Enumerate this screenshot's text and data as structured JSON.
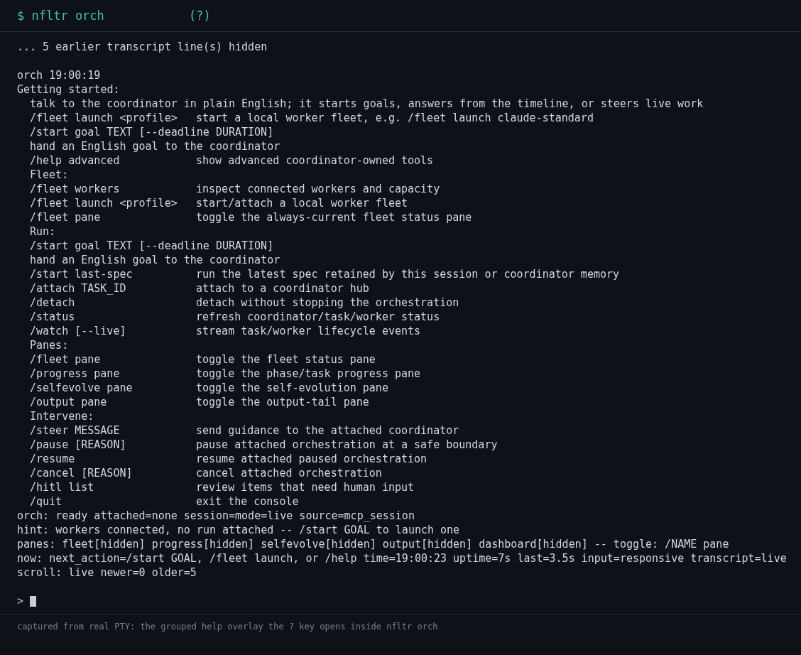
{
  "header": {
    "title": "$ nfltr orch",
    "help": "(?)"
  },
  "transcript": {
    "hidden_notice": "... 5 earlier transcript line(s) hidden",
    "entry": {
      "stamp": "orch 19:00:19",
      "lines": [
        {
          "kind": "heading",
          "text": "Getting started:"
        },
        {
          "kind": "text",
          "text": "talk to the coordinator in plain English; it starts goals, answers from the timeline, or steers live work"
        },
        {
          "kind": "command",
          "command": "/fleet launch <profile>",
          "description": "start a local worker fleet, e.g. /fleet launch claude-standard"
        },
        {
          "kind": "text",
          "text": "/start goal TEXT [--deadline DURATION]"
        },
        {
          "kind": "text",
          "text": "hand an English goal to the coordinator"
        },
        {
          "kind": "command",
          "command": "/help advanced",
          "description": "show advanced coordinator-owned tools"
        },
        {
          "kind": "text",
          "text": "Fleet:"
        },
        {
          "kind": "command",
          "command": "/fleet workers",
          "description": "inspect connected workers and capacity"
        },
        {
          "kind": "command",
          "command": "/fleet launch <profile>",
          "description": "start/attach a local worker fleet"
        },
        {
          "kind": "command",
          "command": "/fleet pane",
          "description": "toggle the always-current fleet status pane"
        },
        {
          "kind": "text",
          "text": "Run:"
        },
        {
          "kind": "text",
          "text": "/start goal TEXT [--deadline DURATION]"
        },
        {
          "kind": "text",
          "text": "hand an English goal to the coordinator"
        },
        {
          "kind": "command",
          "command": "/start last-spec",
          "description": "run the latest spec retained by this session or coordinator memory"
        },
        {
          "kind": "command",
          "command": "/attach TASK_ID",
          "description": "attach to a coordinator hub"
        },
        {
          "kind": "command",
          "command": "/detach",
          "description": "detach without stopping the orchestration"
        },
        {
          "kind": "command",
          "command": "/status",
          "description": "refresh coordinator/task/worker status"
        },
        {
          "kind": "command",
          "command": "/watch [--live]",
          "description": "stream task/worker lifecycle events"
        },
        {
          "kind": "text",
          "text": "Panes:"
        },
        {
          "kind": "command",
          "command": "/fleet pane",
          "description": "toggle the fleet status pane"
        },
        {
          "kind": "command",
          "command": "/progress pane",
          "description": "toggle the phase/task progress pane"
        },
        {
          "kind": "command",
          "command": "/selfevolve pane",
          "description": "toggle the self-evolution pane"
        },
        {
          "kind": "command",
          "command": "/output pane",
          "description": "toggle the output-tail pane"
        },
        {
          "kind": "text",
          "text": "Intervene:"
        },
        {
          "kind": "command",
          "command": "/steer MESSAGE",
          "description": "send guidance to the attached coordinator"
        },
        {
          "kind": "command",
          "command": "/pause [REASON]",
          "description": "pause attached orchestration at a safe boundary"
        },
        {
          "kind": "command",
          "command": "/resume",
          "description": "resume attached paused orchestration"
        },
        {
          "kind": "command",
          "command": "/cancel [REASON]",
          "description": "cancel attached orchestration"
        },
        {
          "kind": "command",
          "command": "/hitl list",
          "description": "review items that need human input"
        },
        {
          "kind": "command",
          "command": "/quit",
          "description": "exit the console"
        }
      ]
    },
    "status_lines": [
      "orch: ready attached=none session=mode=live source=mcp_session",
      "hint: workers connected, no run attached -- /start GOAL to launch one",
      "panes: fleet[hidden] progress[hidden] selfevolve[hidden] output[hidden] dashboard[hidden] -- toggle: /NAME pane",
      "now: next_action=/start GOAL, /fleet launch, or /help time=19:00:23 uptime=7s last=3.5s input=responsive transcript=live",
      "scroll: live newer=0 older=5"
    ]
  },
  "prompt": {
    "symbol": ">"
  },
  "caption": "captured from real PTY: the grouped help overlay the ? key opens inside nfltr orch"
}
